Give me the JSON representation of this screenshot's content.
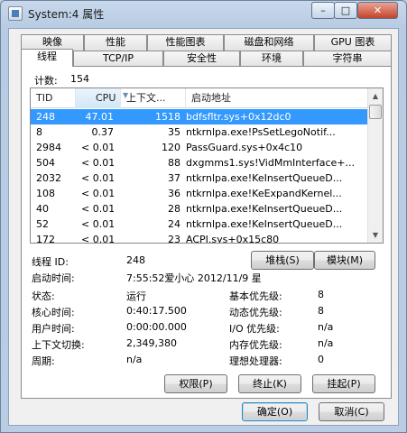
{
  "window": {
    "title": "System:4 属性",
    "minimize": "–",
    "maximize": "□",
    "close": "✕"
  },
  "tabs_row1": [
    "映像",
    "性能",
    "性能图表",
    "磁盘和网络",
    "GPU 图表"
  ],
  "tabs_row2": [
    "线程",
    "TCP/IP",
    "安全性",
    "环境",
    "字符串"
  ],
  "active_tab": "线程",
  "thread_count": {
    "label": "计数:",
    "value": "154"
  },
  "thread_list": {
    "columns": [
      "TID",
      "CPU",
      "上下文...",
      "启动地址"
    ],
    "sorted_column": "CPU",
    "rows": [
      {
        "tid": "248",
        "cpu": "47.01",
        "ctx": "1518",
        "addr": "bdfsfltr.sys+0x12dc0",
        "selected": true
      },
      {
        "tid": "8",
        "cpu": "0.37",
        "ctx": "35",
        "addr": "ntkrnlpa.exe!PsSetLegoNotif..."
      },
      {
        "tid": "2984",
        "cpu": "< 0.01",
        "ctx": "120",
        "addr": "PassGuard.sys+0x4c10"
      },
      {
        "tid": "504",
        "cpu": "< 0.01",
        "ctx": "88",
        "addr": "dxgmms1.sys!VidMmInterface+..."
      },
      {
        "tid": "2032",
        "cpu": "< 0.01",
        "ctx": "37",
        "addr": "ntkrnlpa.exe!KeInsertQueueD..."
      },
      {
        "tid": "108",
        "cpu": "< 0.01",
        "ctx": "36",
        "addr": "ntkrnlpa.exe!KeExpandKernel..."
      },
      {
        "tid": "40",
        "cpu": "< 0.01",
        "ctx": "28",
        "addr": "ntkrnlpa.exe!KeInsertQueueD..."
      },
      {
        "tid": "52",
        "cpu": "< 0.01",
        "ctx": "24",
        "addr": "ntkrnlpa.exe!KeInsertQueueD..."
      },
      {
        "tid": "172",
        "cpu": "< 0.01",
        "ctx": "23",
        "addr": "ACPI.sys+0x15c80"
      }
    ]
  },
  "details": {
    "thread_id_label": "线程 ID:",
    "thread_id": "248",
    "start_time_label": "启动时间:",
    "start_time": "7:55:52爱小心   2012/11/9 星",
    "state_label": "状态:",
    "state": "运行",
    "base_priority_label": "基本优先级:",
    "base_priority": "8",
    "kernel_time_label": "核心时间:",
    "kernel_time": "0:40:17.500",
    "dynamic_priority_label": "动态优先级:",
    "dynamic_priority": "8",
    "user_time_label": "用户时间:",
    "user_time": "0:00:00.000",
    "io_priority_label": "I/O 优先级:",
    "io_priority": "n/a",
    "context_switch_label": "上下文切换:",
    "context_switch": "2,349,380",
    "memory_priority_label": "内存优先级:",
    "memory_priority": "n/a",
    "cycles_label": "周期:",
    "cycles": "n/a",
    "ideal_processor_label": "理想处理器:",
    "ideal_processor": "0"
  },
  "buttons": {
    "stack": "堆栈(S)",
    "module": "模块(M)",
    "permissions": "权限(P)",
    "kill": "终止(K)",
    "suspend": "挂起(P)",
    "ok": "确定(O)",
    "cancel": "取消(C)"
  }
}
